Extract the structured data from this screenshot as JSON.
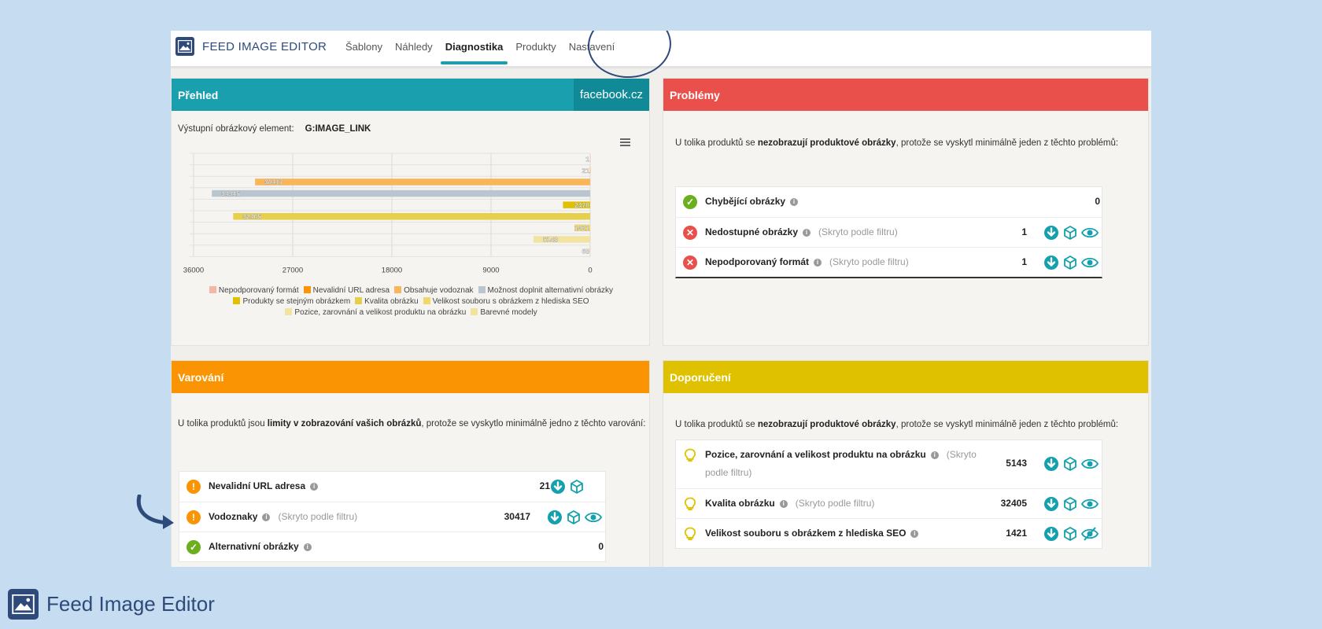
{
  "app": {
    "brand": "FEED IMAGE EDITOR",
    "nav": [
      "Šablony",
      "Náhledy",
      "Diagnostika",
      "Produkty",
      "Nastavení"
    ],
    "active_tab": "Diagnostika"
  },
  "overview": {
    "title": "Přehled",
    "source": "facebook.cz",
    "output_label": "Výstupní obrázkový element:",
    "output_value": "G:IMAGE_LINK"
  },
  "chart_data": {
    "type": "bar",
    "orientation": "horizontal-reversed",
    "categories": [
      "Nepodporovaný formát",
      "Nevalidní URL adresa",
      "Obsahuje vodoznak",
      "Možnost doplnit alternativní obrázky",
      "Produkty se stejným obrázkem",
      "Kvalita obrázku",
      "Velikost souboru s obrázkem z hlediska SEO",
      "Pozice, zarovnání a velikost produktu na obrázku",
      "Barevné modely"
    ],
    "values": [
      1,
      21,
      30417,
      34345,
      2470,
      32405,
      1421,
      5143,
      68
    ],
    "value_labels": [
      "1",
      "21",
      "30417",
      "34345",
      "2470",
      "32405",
      "1421",
      "5143",
      "68"
    ],
    "colors": [
      "#f4b6a6",
      "#fb9403",
      "#f9b55a",
      "#b9c6cf",
      "#e0c100",
      "#e6cf4a",
      "#efd86e",
      "#f3e3a1",
      "#f2e39a"
    ],
    "xticks": [
      "36000",
      "27000",
      "18000",
      "9000",
      "0"
    ],
    "xlim": [
      36000,
      0
    ],
    "grid": true,
    "legend_position": "bottom"
  },
  "problems": {
    "title": "Problémy",
    "intro_pre": "U tolika produktů se ",
    "intro_bold": "nezobrazují produktové obrázky",
    "intro_post": ", protože se vyskytl minimálně jeden z těchto problémů:",
    "items": [
      {
        "label": "Chybějící obrázky",
        "filter": "",
        "count": "0",
        "status": "ok"
      },
      {
        "label": "Nedostupné obrázky",
        "filter": "(Skryto podle filtru)",
        "count": "1",
        "status": "error"
      },
      {
        "label": "Nepodporovaný formát",
        "filter": "(Skryto podle filtru)",
        "count": "1",
        "status": "error"
      }
    ]
  },
  "warnings": {
    "title": "Varování",
    "intro_pre": "U tolika produktů jsou ",
    "intro_bold": "limity v zobrazování vašich obrázků",
    "intro_post": ", protože se vyskytlo minimálně jedno z těchto varování:",
    "items": [
      {
        "label": "Nevalidní URL adresa",
        "filter": "",
        "count": "21",
        "status": "warn"
      },
      {
        "label": "Vodoznaky",
        "filter": "(Skryto podle filtru)",
        "count": "30417",
        "status": "warn"
      },
      {
        "label": "Alternativní obrázky",
        "filter": "",
        "count": "0",
        "status": "ok"
      }
    ]
  },
  "recommendations": {
    "title": "Doporučení",
    "intro_pre": "U tolika produktů se ",
    "intro_bold": "nezobrazují produktové obrázky",
    "intro_post": ", protože se vyskytl minimálně jeden z těchto problémů:",
    "items": [
      {
        "label": "Pozice, zarovnání a velikost produktu na obrázku",
        "filter": "(Skryto podle filtru)",
        "count": "5143"
      },
      {
        "label": "Kvalita obrázku",
        "filter": "(Skryto podle filtru)",
        "count": "32405"
      },
      {
        "label": "Velikost souboru s obrázkem z hlediska SEO",
        "filter": "",
        "count": "1421"
      }
    ]
  },
  "footer": {
    "brand": "Feed Image Editor"
  }
}
